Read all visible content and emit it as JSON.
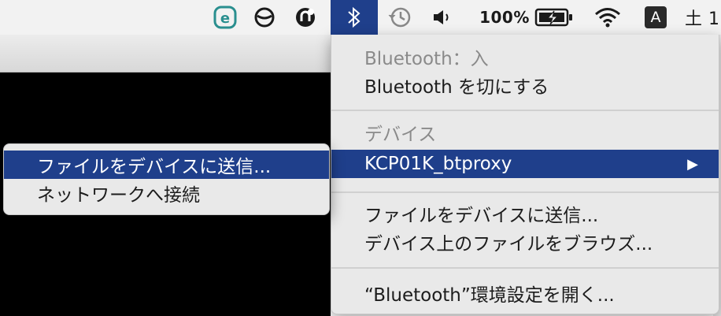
{
  "menubar": {
    "input_source": "A",
    "battery_percent": "100%",
    "clock_partial": "土 1"
  },
  "bluetooth_menu": {
    "status": "Bluetooth：入",
    "toggle": "Bluetooth を切にする",
    "devices_header": "デバイス",
    "device_name": "KCP01K_btproxy",
    "send_file": "ファイルをデバイスに送信...",
    "browse_files": "デバイス上のファイルをブラウズ...",
    "open_prefs": "“Bluetooth”環境設定を開く..."
  },
  "device_submenu": {
    "send_file": "ファイルをデバイスに送信...",
    "connect_network": "ネットワークへ接続"
  },
  "colors": {
    "highlight": "#1f3f8b",
    "menu_bg": "#e9e9e9",
    "menubar_bg": "#f2f2f2"
  }
}
